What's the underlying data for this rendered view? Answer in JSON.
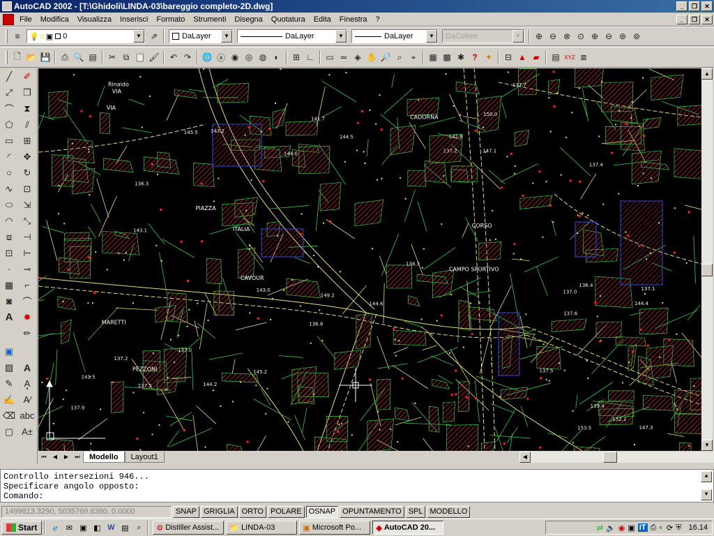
{
  "titlebar": {
    "title": "AutoCAD 2002 - [T:\\Ghidoli\\LINDA-03\\bareggio completo-2D.dwg]"
  },
  "menu": [
    "File",
    "Modifica",
    "Visualizza",
    "Inserisci",
    "Formato",
    "Strumenti",
    "Disegna",
    "Quotatura",
    "Edita",
    "Finestra",
    "?"
  ],
  "layerbar": {
    "layer_value": "0",
    "color_value": "DaLayer",
    "linetype_value": "DaLayer",
    "lineweight_value": "DaLayer",
    "plotstyle_value": "DaColore"
  },
  "tabs": {
    "model": "Modello",
    "layout": "Layout1"
  },
  "command_lines": [
    "Controllo intersezioni 946...",
    "Specificare angolo opposto:",
    "Comando:"
  ],
  "status": {
    "coords": "1499813.3290, 5035769.8380, 0.0000",
    "buttons": [
      "SNAP",
      "GRIGLIA",
      "ORTO",
      "POLARE",
      "OSNAP",
      "OPUNTAMENTO",
      "SPL",
      "MODELLO"
    ]
  },
  "taskbar": {
    "start": "Start",
    "tasks": [
      "Distiller Assist...",
      "LINDA-03",
      "Microsoft Po...",
      "AutoCAD 20..."
    ],
    "clock": "16.14",
    "lang": "IT"
  },
  "map": {
    "labels": [
      "137.6",
      "145.5",
      "136.3",
      "VIA",
      "CAMPO SPORTIVO",
      "147.3",
      "137.9",
      "137.2",
      "CADORNA",
      "145.2",
      "VIA",
      "MARETTI",
      "141.7",
      "PIAZZA",
      "CAVOUR",
      "137.4",
      "137.5",
      "144.2",
      "137.0",
      "137.2",
      "137.7",
      "143.0",
      "153.5",
      "Rinaldo",
      "136.8",
      "144.6",
      "144.5",
      "137.0",
      "138.3",
      "139.4",
      "147.1",
      "137.5",
      "143.1",
      "136.4",
      "137.1",
      "141.5",
      "144.4",
      "CORSO",
      "ITALIA",
      "PEZZONI",
      "152.1",
      "149.2",
      "143.2",
      "142.8",
      "150.0",
      "144.0"
    ]
  },
  "colors": {
    "titlebar": "#0a246a",
    "canvas": "#000000",
    "building_red": "#c0282c",
    "lot_green": "#3cc848",
    "road_yellow": "#e8e080",
    "highlight_blue": "#3040c0"
  }
}
